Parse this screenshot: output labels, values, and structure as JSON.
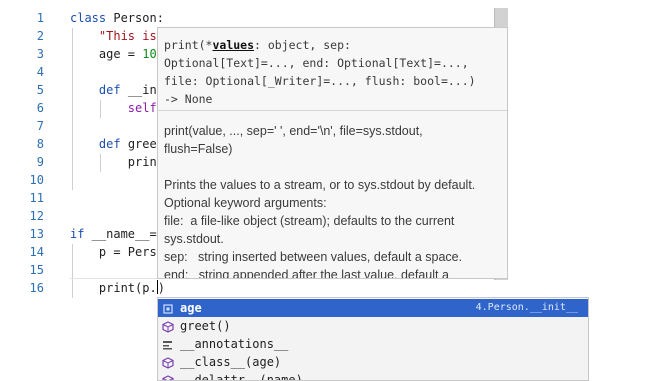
{
  "editor": {
    "line_numbers": [
      "1",
      "2",
      "3",
      "4",
      "5",
      "6",
      "7",
      "8",
      "9",
      "10",
      "11",
      "12",
      "13",
      "14",
      "15",
      "16"
    ],
    "lines": [
      {
        "parts": [
          {
            "t": "class",
            "k": "kw"
          },
          {
            "t": " Person:"
          }
        ]
      },
      {
        "parts": [
          {
            "t": "    "
          },
          {
            "t": "\"This is",
            "k": "str"
          }
        ]
      },
      {
        "parts": [
          {
            "t": "    age = "
          },
          {
            "t": "10",
            "k": "num"
          }
        ]
      },
      {
        "parts": []
      },
      {
        "parts": [
          {
            "t": "    "
          },
          {
            "t": "def",
            "k": "kw"
          },
          {
            "t": " __in"
          }
        ]
      },
      {
        "parts": [
          {
            "t": "        "
          },
          {
            "t": "self",
            "k": "self"
          }
        ]
      },
      {
        "parts": []
      },
      {
        "parts": [
          {
            "t": "    "
          },
          {
            "t": "def",
            "k": "kw"
          },
          {
            "t": " gree"
          }
        ]
      },
      {
        "parts": [
          {
            "t": "        prin"
          }
        ]
      },
      {
        "parts": []
      },
      {
        "parts": []
      },
      {
        "parts": []
      },
      {
        "parts": [
          {
            "t": "if",
            "k": "kw"
          },
          {
            "t": " __name__="
          }
        ]
      },
      {
        "parts": [
          {
            "t": "    p = Pers"
          }
        ]
      },
      {
        "parts": []
      },
      {
        "parts": [
          {
            "t": "    print(p."
          }
        ]
      }
    ]
  },
  "doc_tooltip": {
    "sig_prefix": "print(*",
    "sig_param": "values",
    "sig_rest_1": ": object, sep:",
    "sig_line_2": "Optional[Text]=..., end: Optional[Text]=...,",
    "sig_line_3": "file: Optional[_Writer]=..., flush: bool=...)",
    "sig_line_4": "-> None",
    "usage_1": "print(value, ..., sep=' ', end='\\n', file=sys.stdout,",
    "usage_2": "flush=False)",
    "desc_1": "Prints the values to a stream, or to sys.stdout by default.",
    "desc_2": "Optional keyword arguments:",
    "desc_3": "file:  a file-like object (stream); defaults to the current",
    "desc_4": "sys.stdout.",
    "desc_5": "sep:   string inserted between values, default a space.",
    "desc_6": "end:   string appended after the last value, default a"
  },
  "completion": {
    "items": [
      {
        "label": "age",
        "icon": "field-icon",
        "detail": "4.Person.__init__"
      },
      {
        "label": "greet()",
        "icon": "method-icon",
        "detail": ""
      },
      {
        "label": "__annotations__",
        "icon": "field-icon",
        "detail": ""
      },
      {
        "label": "__class__(age)",
        "icon": "method-icon",
        "detail": ""
      },
      {
        "label": "__delattr__(name)",
        "icon": "method-icon",
        "detail": ""
      }
    ]
  },
  "colors": {
    "selection": "#2f65ca",
    "keyword": "#1b4fb0",
    "string": "#a3151d",
    "number": "#0e8a16",
    "line_number": "#2d6fb4"
  }
}
